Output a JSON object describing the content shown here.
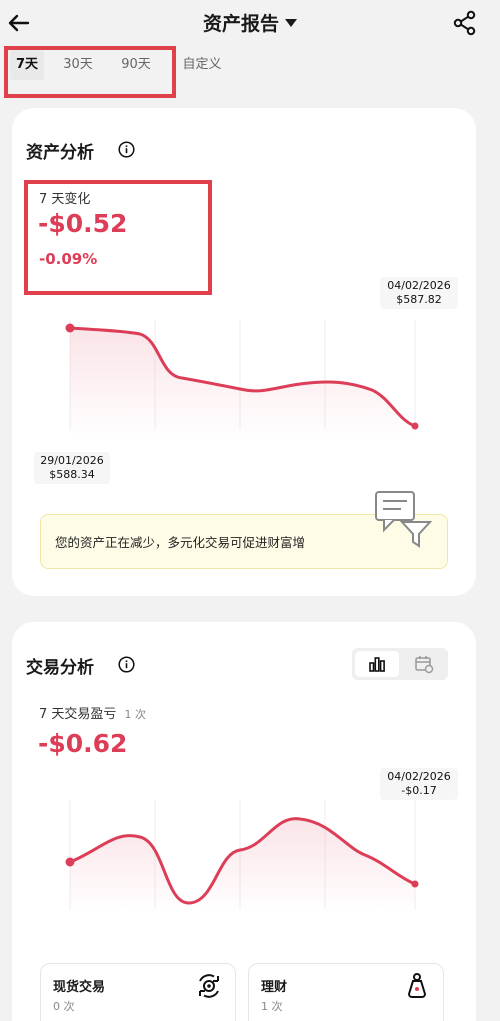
{
  "header": {
    "title": "资产报告"
  },
  "tabs": [
    {
      "label": "7天",
      "active": true
    },
    {
      "label": "30天",
      "active": false
    },
    {
      "label": "90天",
      "active": false
    },
    {
      "label": "自定义",
      "active": false
    }
  ],
  "asset": {
    "title": "资产分析",
    "change_label": "7 天变化",
    "change_value": "-$0.52",
    "change_pct": "-0.09%",
    "tip_end": {
      "date": "04/02/2026",
      "value": "$587.82"
    },
    "tip_start": {
      "date": "29/01/2026",
      "value": "$588.34"
    },
    "notice": "您的资产正在减少，多元化交易可促进财富增"
  },
  "trade": {
    "title": "交易分析",
    "pnl_label": "7 天交易盈亏",
    "pnl_count": "1 次",
    "pnl_value": "-$0.62",
    "tip_end": {
      "date": "04/02/2026",
      "value": "-$0.17"
    }
  },
  "cards": [
    {
      "name": "现货交易",
      "count": "0 次",
      "icon": "target-icon"
    },
    {
      "name": "理财",
      "count": "1 次",
      "icon": "wealth-bag-icon"
    }
  ],
  "colors": {
    "accent": "#dd3e57",
    "highlight": "#e0404c",
    "notice_bg": "#fefbe6"
  }
}
